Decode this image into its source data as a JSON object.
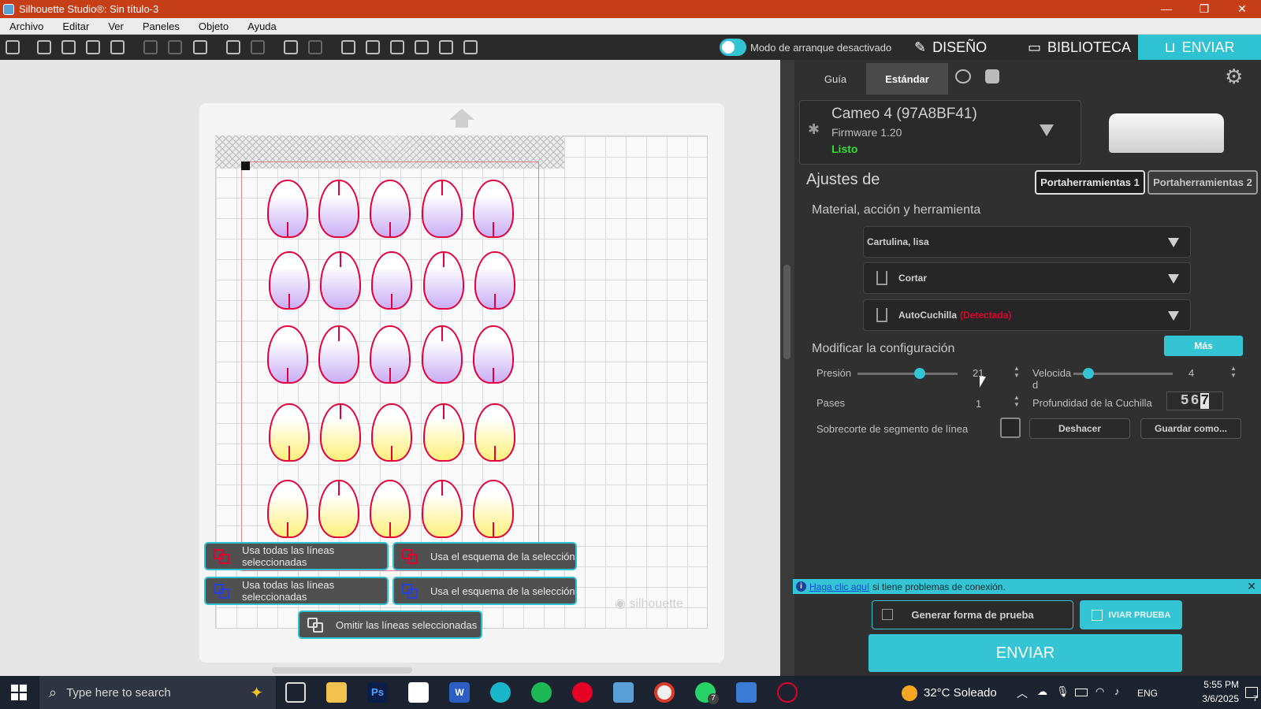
{
  "window": {
    "title": "Silhouette Studio®: Sin título-3",
    "controls": [
      "—",
      "❐",
      "✕"
    ]
  },
  "menu": [
    "Archivo",
    "Editar",
    "Ver",
    "Paneles",
    "Objeto",
    "Ayuda"
  ],
  "toolbar": {
    "toggle_label": "Modo de arranque desactivado",
    "tabs": {
      "design": "DISEÑO",
      "library": "BIBLIOTECA",
      "send": "ENVIAR"
    }
  },
  "canvas": {
    "watermark": "silhouette",
    "actions": {
      "red_all_lines": "Usa todas las líneas seleccionadas",
      "red_outline": "Usa el esquema de la selección",
      "blue_all_lines": "Usa todas las líneas seleccionadas",
      "blue_outline": "Usa el esquema de la selección",
      "skip_lines": "Omitir las líneas seleccionadas"
    },
    "colors": {
      "cut_line": "#e3003c",
      "purple_fill": "#c9aff5",
      "yellow_fill": "#fff07a"
    }
  },
  "panel": {
    "subtabs": {
      "guide": "Guía",
      "standard": "Estándar"
    },
    "device": {
      "name": "Cameo 4 (97A8BF41)",
      "firmware": "Firmware 1.20",
      "status": "Listo"
    },
    "settings_title": "Ajustes de",
    "tool_holders": {
      "one": "Portaherramientas 1",
      "two": "Portaherramientas 2"
    },
    "section_material": "Material, acción y herramienta",
    "material": "Cartulina, lisa",
    "action": "Cortar",
    "tool": {
      "name": "AutoCuchilla",
      "detected": "(Detectada)"
    },
    "section_modify": "Modificar la configuración",
    "more_button": "Más",
    "pressure": {
      "label": "Presión",
      "value": "21",
      "level": 0.62
    },
    "speed": {
      "label": "Velocida d",
      "value": "4",
      "level": 0.15
    },
    "passes": {
      "label": "Pases",
      "value": "1"
    },
    "blade_depth": {
      "label": "Profundidad de la Cuchilla",
      "digits": [
        "5",
        "6",
        "7"
      ]
    },
    "overcut": {
      "label": "Sobrecorte de segmento de línea"
    },
    "undo_button": "Deshacer",
    "save_as_button": "Guardar como...",
    "info": {
      "link": "Haga clic aquí",
      "text": "si tiene problemas de conexión."
    },
    "generate_test_button": "Generar forma de prueba",
    "send_test_button": "IVIAR PRUEBA",
    "send_button": "ENVIAR"
  },
  "taskbar": {
    "search_placeholder": "Type here to search",
    "weather": "32°C  Soleado",
    "lang": "ENG",
    "time": "5:55 PM",
    "date": "3/6/2025",
    "whatsapp_badge": "7",
    "notif_badge": "7"
  }
}
